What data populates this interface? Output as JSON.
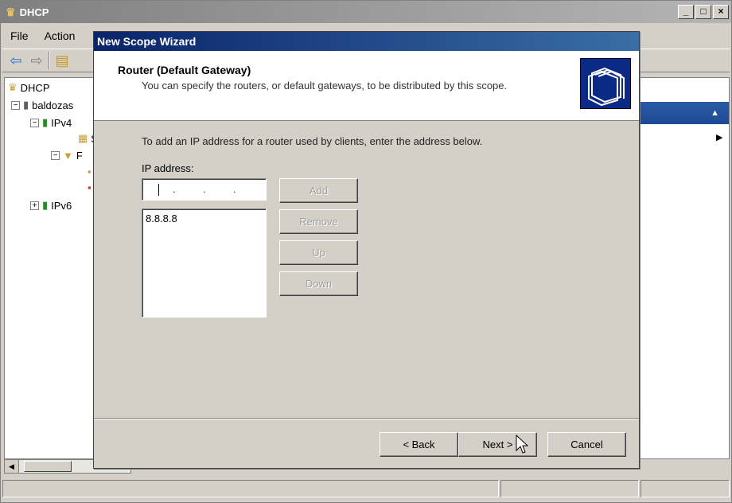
{
  "main_window": {
    "title": "DHCP",
    "window_buttons": [
      "_",
      "□",
      "×"
    ],
    "menu": [
      "File",
      "Action"
    ],
    "tree": {
      "root_label": "DHCP",
      "server_label": "baldozas",
      "ipv4_label": "IPv4",
      "scope_label": "S",
      "filter_label": "F",
      "ipv6_label": "IPv6"
    }
  },
  "wizard": {
    "title": "New Scope Wizard",
    "header_title": "Router (Default Gateway)",
    "header_subtitle": "You can specify the routers, or default gateways, to be distributed by this scope.",
    "instruction": "To add an IP address for a router used by clients, enter the address below.",
    "ip_label": "IP address:",
    "ip_list": [
      "8.8.8.8"
    ],
    "buttons": {
      "add": "Add",
      "remove": "Remove",
      "up": "Up",
      "down": "Down",
      "back": "< Back",
      "next": "Next >",
      "cancel": "Cancel"
    }
  },
  "colors": {
    "wizard_title_bar": "#0a246a",
    "actions_header": "#2b5aa6",
    "dialog_face": "#d4d0c8"
  }
}
